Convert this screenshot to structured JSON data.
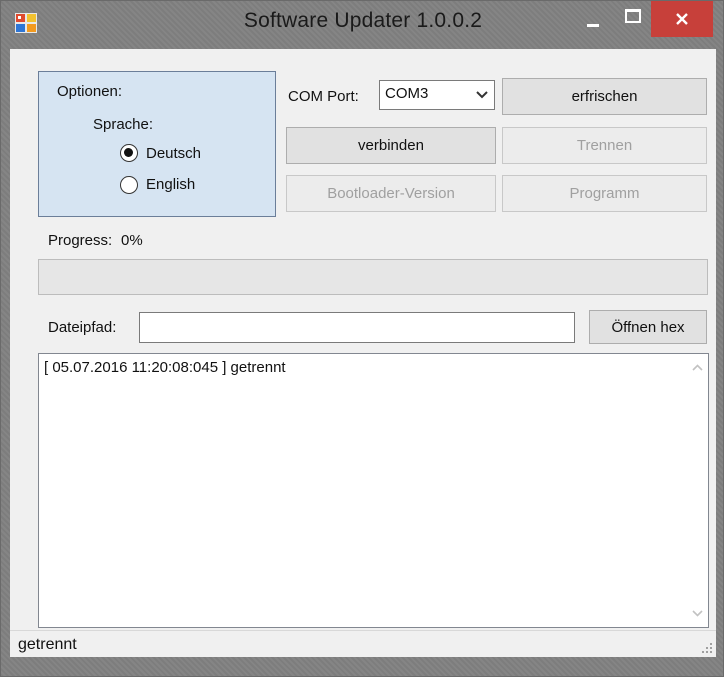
{
  "window": {
    "title": "Software Updater 1.0.0.2"
  },
  "options": {
    "title": "Optionen:",
    "language_label": "Sprache:",
    "languages": [
      {
        "label": "Deutsch",
        "checked": true
      },
      {
        "label": "English",
        "checked": false
      }
    ]
  },
  "connection": {
    "com_port_label": "COM Port:",
    "com_port_value": "COM3",
    "refresh_label": "erfrischen",
    "connect_label": "verbinden",
    "disconnect_label": "Trennen",
    "bootloader_label": "Bootloader-Version",
    "program_label": "Programm"
  },
  "progress": {
    "label": "Progress:",
    "value_text": "0%",
    "value": 0
  },
  "file": {
    "path_label": "Dateipfad:",
    "path_value": "",
    "open_label": "Öffnen hex"
  },
  "log": {
    "entries": [
      "[ 05.07.2016 11:20:08:045 ] getrennt"
    ]
  },
  "status": {
    "text": "getrennt"
  },
  "colors": {
    "close_button": "#c7403a",
    "options_panel": "#d6e4f2",
    "progress_fill": "#06b025"
  },
  "icons": [
    "app-icon",
    "minimize-icon",
    "maximize-icon",
    "close-icon",
    "chevron-down-icon",
    "scroll-up-icon",
    "scroll-down-icon",
    "size-grip-icon"
  ]
}
